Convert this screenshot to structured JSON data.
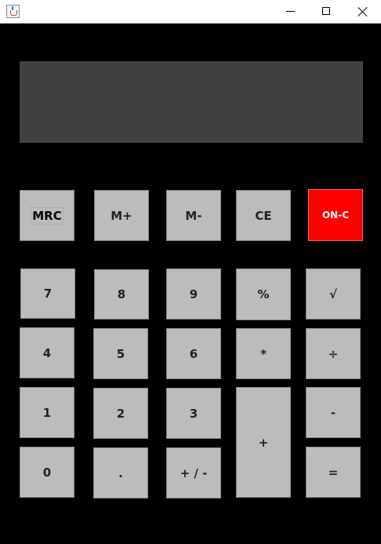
{
  "window": {
    "icon": "java-cup-icon",
    "controls": {
      "minimize": "minimize-icon",
      "maximize": "maximize-icon",
      "close": "close-icon"
    }
  },
  "display": {
    "value": ""
  },
  "keys": {
    "mrc": "MRC",
    "m_plus": "M+",
    "m_minus": "M-",
    "ce": "CE",
    "on_c": "ON-C",
    "seven": "7",
    "eight": "8",
    "nine": "9",
    "percent": "%",
    "sqrt": "√",
    "four": "4",
    "five": "5",
    "six": "6",
    "multiply": "*",
    "divide": "÷",
    "one": "1",
    "two": "2",
    "three": "3",
    "plus": "+",
    "minus": "-",
    "zero": "0",
    "dot": ".",
    "sign": "+ / -",
    "equals": "="
  },
  "colors": {
    "background": "#000000",
    "display": "#404040",
    "key": "#bcbcbc",
    "on_c": "#ff0000"
  }
}
